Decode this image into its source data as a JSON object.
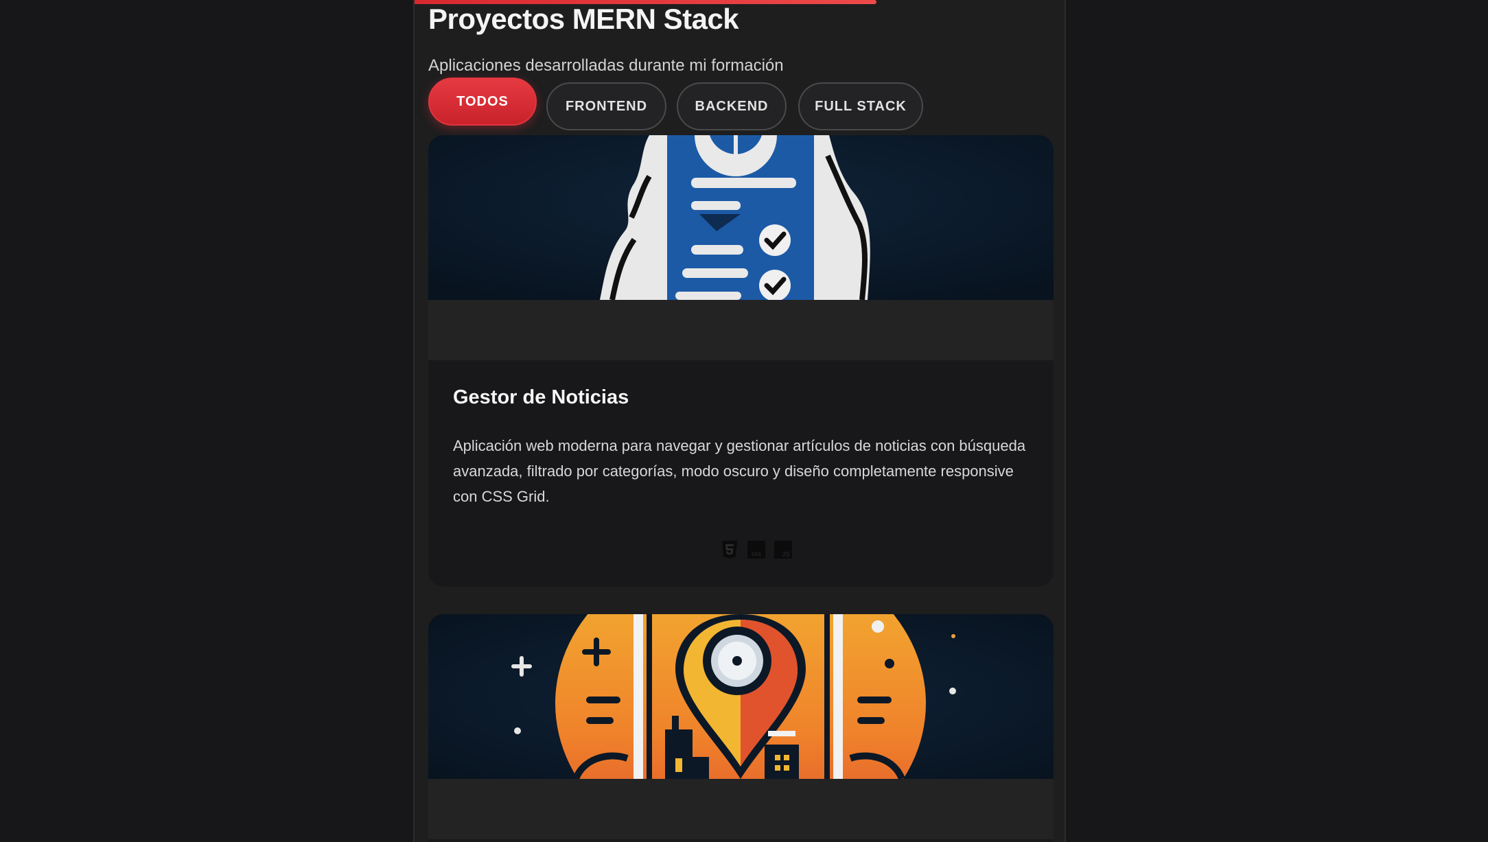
{
  "header": {
    "title": "Proyectos MERN Stack",
    "subtitle": "Aplicaciones desarrolladas durante mi formación"
  },
  "filters": [
    {
      "label": "TODOS",
      "active": true
    },
    {
      "label": "FRONTEND",
      "active": false
    },
    {
      "label": "BACKEND",
      "active": false
    },
    {
      "label": "FULL STACK",
      "active": false
    }
  ],
  "projects": [
    {
      "title": "Gestor de Noticias",
      "description": "Aplicación web moderna para navegar y gestionar artículos de noticias con búsqueda avanzada, filtrado por categorías, modo oscuro y diseño completamente responsive con CSS Grid.",
      "tech_icons": [
        "html5-icon",
        "css3-icon",
        "javascript-icon"
      ]
    },
    {
      "title": "",
      "description": ""
    }
  ],
  "colors": {
    "accent": "#e3353d",
    "background": "#171719",
    "panel": "#1e1e1f",
    "card_image_bg": "#0d1a2a"
  }
}
